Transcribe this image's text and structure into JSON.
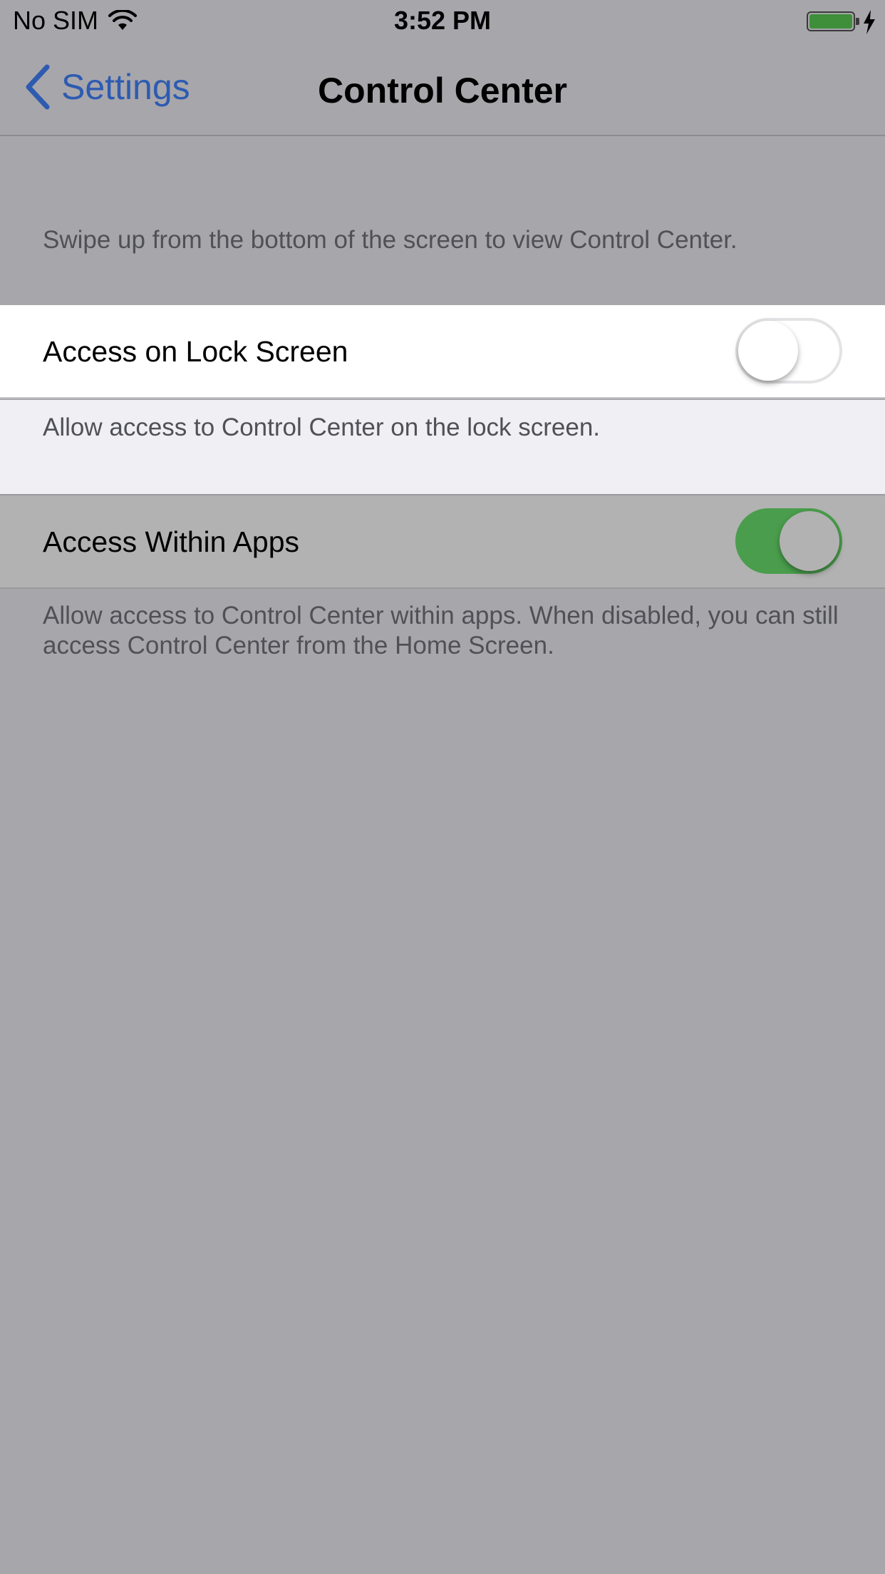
{
  "status_bar": {
    "carrier": "No SIM",
    "time": "3:52 PM"
  },
  "nav": {
    "back_label": "Settings",
    "title": "Control Center"
  },
  "intro_text": "Swipe up from the bottom of the screen to view Control Center.",
  "settings": [
    {
      "label": "Access on Lock Screen",
      "enabled": false,
      "footer": "Allow access to Control Center on the lock screen."
    },
    {
      "label": "Access Within Apps",
      "enabled": true,
      "footer": "Allow access to Control Center within apps. When disabled, you can still access Control Center from the Home Screen."
    }
  ],
  "colors": {
    "accent": "#2d5bb0",
    "toggle_on": "#4a9d4c",
    "battery": "#3f8f3a"
  }
}
